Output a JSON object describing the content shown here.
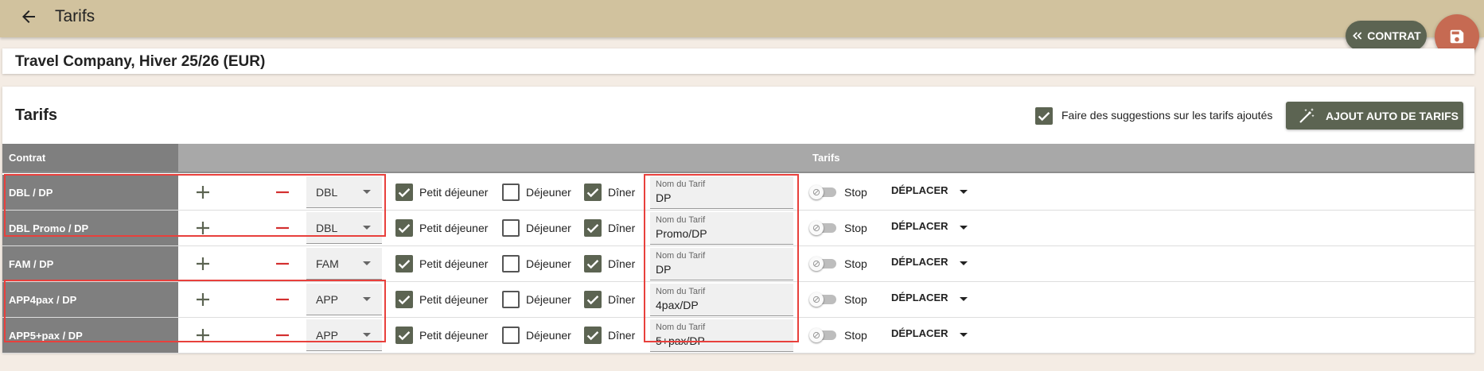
{
  "app": {
    "title": "Tarifs",
    "back_icon": "arrow-left-icon",
    "contract_button_label": "CONTRAT",
    "save_icon": "floppy-disk-icon"
  },
  "contract": {
    "title": "Travel Company, Hiver 25/26 (EUR)"
  },
  "card": {
    "title": "Tarifs",
    "suggest_label": "Faire des suggestions sur les tarifs ajoutés",
    "suggest_checked": true,
    "auto_button_label": "AJOUT AUTO DE TARIFS",
    "auto_button_icon": "magic-wand-icon"
  },
  "table": {
    "col_contrat": "Contrat",
    "col_tarifs": "Tarifs",
    "meals": {
      "breakfast": "Petit déjeuner",
      "lunch": "Déjeuner",
      "dinner": "Dîner"
    },
    "name_field_label": "Nom du Tarif",
    "stop_label": "Stop",
    "move_label": "DÉPLACER",
    "rows": [
      {
        "label": "DBL / DP",
        "room": "DBL",
        "breakfast": true,
        "lunch": false,
        "dinner": true,
        "name": "DP",
        "stop": false
      },
      {
        "label": "DBL Promo / DP",
        "room": "DBL",
        "breakfast": true,
        "lunch": false,
        "dinner": true,
        "name": "Promo/DP",
        "stop": false
      },
      {
        "label": "FAM / DP",
        "room": "FAM",
        "breakfast": true,
        "lunch": false,
        "dinner": true,
        "name": "DP",
        "stop": false
      },
      {
        "label": "APP4pax / DP",
        "room": "APP",
        "breakfast": true,
        "lunch": false,
        "dinner": true,
        "name": "4pax/DP",
        "stop": false
      },
      {
        "label": "APP5+pax / DP",
        "room": "APP",
        "breakfast": true,
        "lunch": false,
        "dinner": true,
        "name": "5+pax/DP",
        "stop": false
      }
    ]
  },
  "colors": {
    "header_bg": "#d1c29e",
    "accent": "#5c6452",
    "save_fab": "#c66a52",
    "highlight": "#e8403c"
  }
}
